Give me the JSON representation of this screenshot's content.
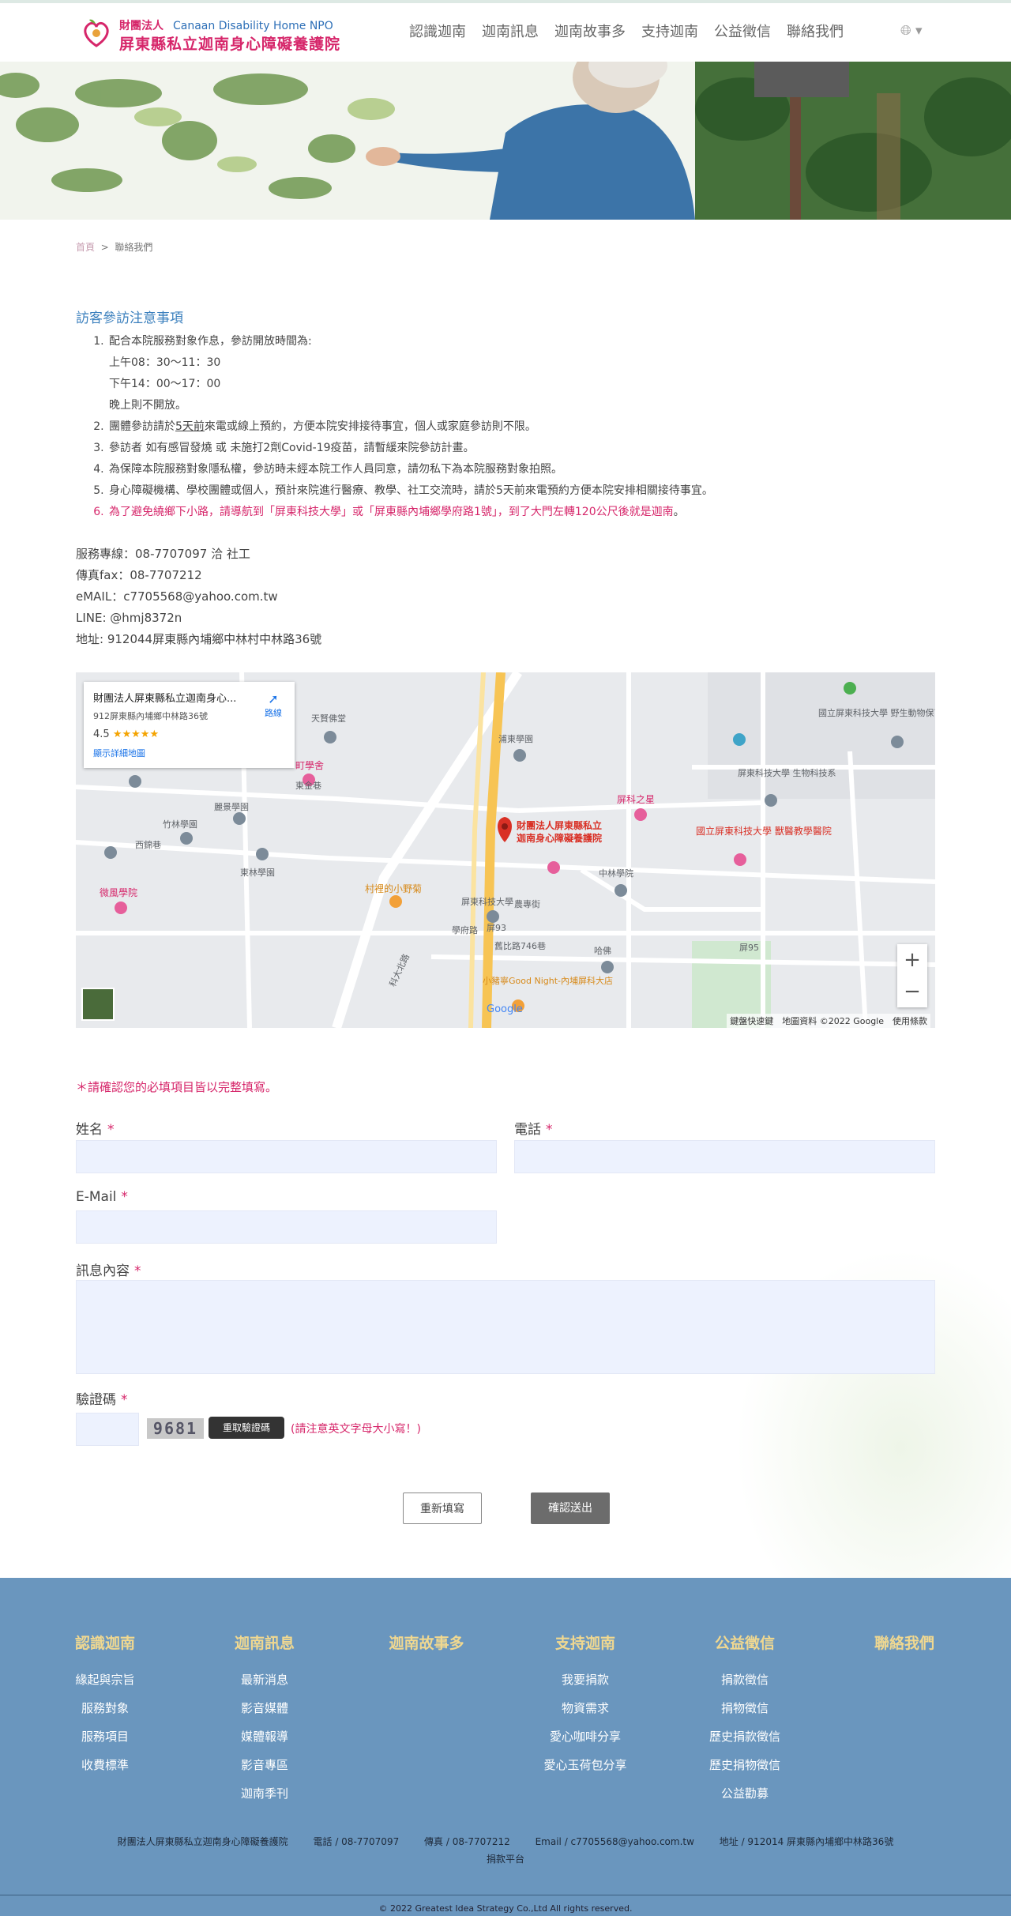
{
  "header": {
    "logo_org_zh": "財團法人",
    "logo_org_en": "Canaan Disability Home NPO",
    "logo_name": "屏東縣私立迦南身心障礙養護院",
    "nav": [
      "認識迦南",
      "迦南訊息",
      "迦南故事多",
      "支持迦南",
      "公益徵信",
      "聯絡我們"
    ],
    "lang_arrow": "▾"
  },
  "breadcrumb": {
    "home": "首頁",
    "sep": ">",
    "current": "聯絡我們"
  },
  "notice": {
    "title": "訪客參訪注意事項",
    "item1": "配合本院服務對象作息，參訪開放時間為:",
    "item1_am": "上午08：30～11：30",
    "item1_pm": "下午14：00～17：00",
    "item1_night": "晚上則不開放。",
    "item2_pre": "團體參訪請於",
    "item2_u": "5天前",
    "item2_post": "來電或線上預約，方便本院安排接待事宜，個人或家庭參訪則不限。",
    "item3": "參訪者 如有感冒發燒 或 未施打2劑Covid-19疫苗，請暫緩來院參訪計畫。",
    "item4": "為保障本院服務對象隱私權，參訪時未經本院工作人員同意，請勿私下為本院服務對象拍照。",
    "item5": "身心障礙機構、學校團體或個人，預計來院進行醫療、教學、社工交流時，請於5天前來電預約方便本院安排相關接待事宜。",
    "item6": "為了避免繞鄉下小路，請導航到「屏東科技大學」或「屏東縣內埔鄉學府路1號」，到了大門左轉120公尺後就是迦南",
    "item6_end": "。"
  },
  "contact": {
    "phone": "服務專線：08-7707097 洽 社工",
    "fax": "傳真fax：08-7707212",
    "email": "eMAIL：c7705568@yahoo.com.tw",
    "line": "LINE: @hmj8372n",
    "address": "地址: 912044屏東縣內埔鄉中林村中林路36號"
  },
  "map": {
    "card_title": "財團法人屏東縣私立迦南身心...",
    "card_address": "912屏東縣內埔鄉中林路36號",
    "card_rating": "4.5",
    "card_stars": "★★★★★",
    "card_directions": "路線",
    "card_link": "顯示詳細地圖",
    "pin_label_1": "財團法人屏東縣私立",
    "pin_label_2": "迦南身心障礙養護院",
    "labels": {
      "temple": "天賢佛堂",
      "school1": "浦東學園",
      "school2": "麗景學園",
      "school3": "竹林學園",
      "school4": "東林學園",
      "school5": "中林學院",
      "school6": "屏東科技大學",
      "school7": "微風學院",
      "store1": "屏科之星",
      "store2": "村裡的小野菊",
      "store3": "小豬寧Good Night-內埔屏科大店",
      "hosp": "國立屏東科技大學 獸醫教學醫院",
      "bio": "屏東科技大學 生物科技系",
      "wild": "國立屏東科技大學 野生動物保育研究",
      "road1": "東金巷",
      "road2": "西錦巷",
      "road3": "學府路",
      "road4": "科大北路",
      "road5": "舊比路746巷",
      "road6": "農專街",
      "school8": "町學舍",
      "shield93": "屏93",
      "shield95": "屏95",
      "hajia": "哈佛"
    },
    "zoom_in": "+",
    "zoom_out": "−",
    "footer": "鍵盤快速鍵　地圖資料 ©2022 Google　使用條款",
    "google": "Google"
  },
  "form": {
    "required_note": "＊請確認您的必填項目皆以完整填寫。",
    "name_label": "姓名",
    "phone_label": "電話",
    "email_label": "E-Mail",
    "message_label": "訊息內容",
    "captcha_label": "驗證碼",
    "required_mark": "*",
    "captcha_code": "9681",
    "refresh_button": "重取驗證碼",
    "captcha_hint": "(請注意英文字母大小寫！)",
    "reset_button": "重新填寫",
    "submit_button": "確認送出"
  },
  "footer": {
    "columns": [
      {
        "title": "認識迦南",
        "links": [
          "緣起與宗旨",
          "服務對象",
          "服務項目",
          "收費標準"
        ]
      },
      {
        "title": "迦南訊息",
        "links": [
          "最新消息",
          "影音媒體",
          "媒體報導",
          "影音專區",
          "迦南季刊"
        ]
      },
      {
        "title": "迦南故事多",
        "links": []
      },
      {
        "title": "支持迦南",
        "links": [
          "我要捐款",
          "物資需求",
          "愛心咖啡分享",
          "愛心玉荷包分享"
        ]
      },
      {
        "title": "公益徵信",
        "links": [
          "捐款徵信",
          "捐物徵信",
          "歷史捐款徵信",
          "歷史捐物徵信",
          "公益勸募"
        ]
      },
      {
        "title": "聯絡我們",
        "links": []
      }
    ],
    "info_org": "財團法人屏東縣私立迦南身心障礙養護院",
    "info_phone": "電話 / 08-7707097",
    "info_fax": "傳真 / 08-7707212",
    "info_email": "Email / c7705568@yahoo.com.tw",
    "info_address": "地址 / 912014 屏東縣內埔鄉中林路36號",
    "info_donate": "捐款平台",
    "copyright": "© 2022 Greatest Idea Strategy Co.,Ltd All rights reserved."
  }
}
